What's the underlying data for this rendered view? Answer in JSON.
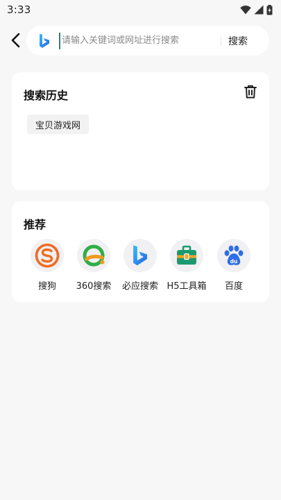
{
  "status_bar": {
    "time": "3:33"
  },
  "search": {
    "engine_logo": "bing-logo-icon",
    "placeholder": "请输入关键词或网址进行搜索",
    "value": "",
    "submit_label": "搜索"
  },
  "history": {
    "title": "搜索历史",
    "items": [
      {
        "label": "宝贝游戏网"
      }
    ]
  },
  "recommend": {
    "title": "推荐",
    "engines": [
      {
        "label": "搜狗",
        "icon": "sogou-icon"
      },
      {
        "label": "360搜索",
        "icon": "360-search-icon"
      },
      {
        "label": "必应搜索",
        "icon": "bing-icon"
      },
      {
        "label": "H5工具箱",
        "icon": "toolbox-icon"
      },
      {
        "label": "百度",
        "icon": "baidu-icon"
      }
    ]
  },
  "colors": {
    "background": "#f7f7f8",
    "card": "#ffffff",
    "sogou": "#f26a21",
    "360_green": "#2fae47",
    "360_orange": "#f39a1e",
    "toolbox_green": "#1a9a6e",
    "toolbox_orange": "#f5a623",
    "baidu": "#2f6ee8",
    "cursor": "#1a8a7a"
  }
}
